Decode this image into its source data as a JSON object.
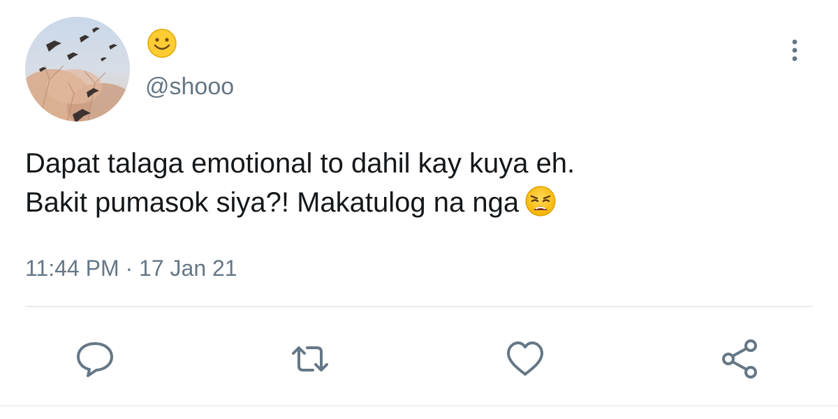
{
  "tweet": {
    "display_name_emoji": "smiling-face-emoji",
    "handle": "@shooo",
    "text_lines": [
      "Dapat talaga emotional to dahil kay kuya eh.",
      "Bakit pumasok siya?! Makatulog na nga"
    ],
    "text_emoji": "weary-face-emoji",
    "time": "11:44 PM",
    "separator": " · ",
    "date": "17 Jan 21"
  },
  "actions": [
    "reply-icon",
    "retweet-icon",
    "like-icon",
    "share-icon"
  ],
  "colors": {
    "text_primary": "#14171a",
    "text_secondary": "#657786",
    "icon": "#657786",
    "divider": "#e6ecf0",
    "emoji_yellow": "#ffcc33"
  }
}
